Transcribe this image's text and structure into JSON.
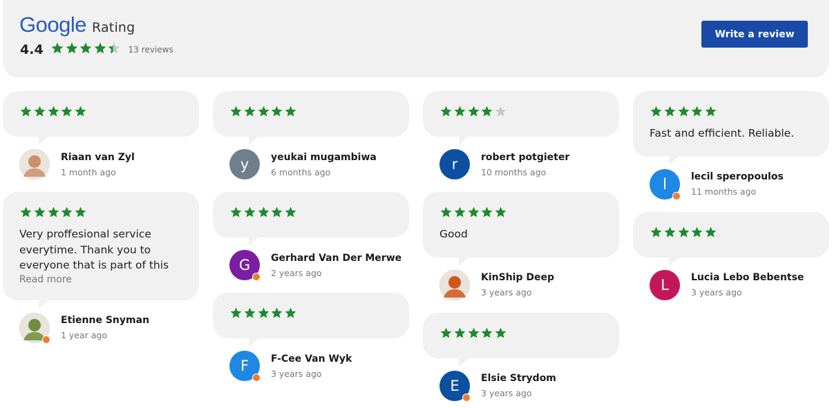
{
  "header": {
    "logo_text": "Google",
    "rating_label": "Rating",
    "average": "4.4",
    "average_value": 4.4,
    "review_count": "13",
    "reviews_word": "reviews",
    "write_review_label": "Write a review"
  },
  "colors": {
    "star_filled": "#1d8a2e",
    "star_empty": "#c8c8c8",
    "button": "#1a4aa8"
  },
  "columns": [
    [
      {
        "stars": 5,
        "text": "",
        "read_more": "",
        "name": "Riaan van Zyl",
        "date": "1 month ago",
        "avatar": {
          "type": "photo",
          "initial": "",
          "color": "#c9906a",
          "badge": false
        }
      },
      {
        "stars": 5,
        "text": "Very proffesional service everytime. Thank you to everyone that is part of this",
        "read_more": "Read more",
        "name": "Etienne Snyman",
        "date": "1 year ago",
        "avatar": {
          "type": "photo",
          "initial": "",
          "color": "#6f8f3a",
          "badge": true
        }
      }
    ],
    [
      {
        "stars": 5,
        "text": "",
        "read_more": "",
        "name": "yeukai mugambiwa",
        "date": "6 months ago",
        "avatar": {
          "type": "letter",
          "initial": "y",
          "color": "#6f7f8c",
          "badge": false
        }
      },
      {
        "stars": 5,
        "text": "",
        "read_more": "",
        "name": "Gerhard Van Der Merwe",
        "date": "2 years ago",
        "avatar": {
          "type": "letter",
          "initial": "G",
          "color": "#7b1fa2",
          "badge": true
        }
      },
      {
        "stars": 5,
        "text": "",
        "read_more": "",
        "name": "F-Cee Van Wyk",
        "date": "3 years ago",
        "avatar": {
          "type": "letter",
          "initial": "F",
          "color": "#1e88e5",
          "badge": true
        }
      }
    ],
    [
      {
        "stars": 4,
        "text": "",
        "read_more": "",
        "name": "robert potgieter",
        "date": "10 months ago",
        "avatar": {
          "type": "letter",
          "initial": "r",
          "color": "#0d4fa0",
          "badge": false
        }
      },
      {
        "stars": 5,
        "text": "Good",
        "read_more": "",
        "name": "KinShip Deep",
        "date": "3 years ago",
        "avatar": {
          "type": "photo",
          "initial": "",
          "color": "#d2571f",
          "badge": false
        }
      },
      {
        "stars": 5,
        "text": "",
        "read_more": "",
        "name": "Elsie Strydom",
        "date": "3 years ago",
        "avatar": {
          "type": "letter",
          "initial": "E",
          "color": "#0d4fa0",
          "badge": true
        }
      }
    ],
    [
      {
        "stars": 5,
        "text": "Fast and efficient. Reliable.",
        "read_more": "",
        "name": "lecil speropoulos",
        "date": "11 months ago",
        "avatar": {
          "type": "letter",
          "initial": "l",
          "color": "#1e88e5",
          "badge": true
        }
      },
      {
        "stars": 5,
        "text": "",
        "read_more": "",
        "name": "Lucia Lebo Bebentse",
        "date": "3 years ago",
        "avatar": {
          "type": "letter",
          "initial": "L",
          "color": "#c2185b",
          "badge": false
        }
      }
    ]
  ]
}
